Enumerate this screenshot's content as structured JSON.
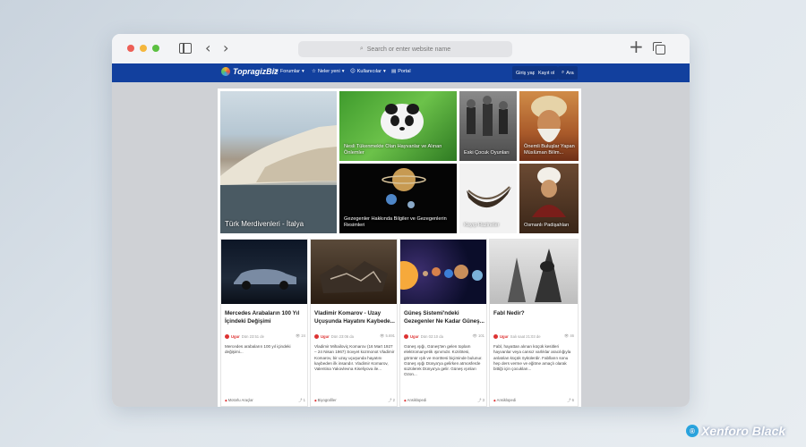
{
  "browser": {
    "url_placeholder": "Search or enter website name",
    "traffic_lights": [
      "#ed5f56",
      "#f5b73d",
      "#5cc041"
    ]
  },
  "forum": {
    "logo": "TopragizBiz",
    "nav": {
      "forums": "Forumlar",
      "whats_new": "Neler yeni",
      "members": "Kullanıcılar",
      "portal": "Portal",
      "login": "Giriş yap",
      "register": "Kayıt ol",
      "search": "Ara"
    },
    "colors": {
      "nav_bg": "#12409e",
      "accent_red": "#d33333"
    }
  },
  "featured": [
    {
      "title": "Türk Merdivenleri - İtalya"
    },
    {
      "title": "Nesli Tükenmekte Olan Hayvanlar ve Alınan Önlemler"
    },
    {
      "title": "Eski Çocuk Oyunları"
    },
    {
      "title": "Önemli Buluşlar Yapan Müslüman Bilim..."
    },
    {
      "title": "Gezegenler Hakkında Bilgiler ve Gezegenlerin Resimleri"
    },
    {
      "title": "Kayıp Hazineler"
    },
    {
      "title": "Osmanlı Padişahları"
    }
  ],
  "articles": [
    {
      "title": "Mercedes Arabaların 100 Yıl İçindeki Değişimi",
      "author": "Ugur",
      "date": "Dün 23:51 de",
      "views": "24",
      "excerpt": "Mercedes arabaların 100 yıl içindeki değişimi...",
      "category": "Motorlu Araçlar",
      "comments": "1"
    },
    {
      "title": "Vladimir Komarov - Uzay Uçuşunda Hayatını Kaybede...",
      "author": "Ugur",
      "date": "Dün 23:06 da",
      "views": "5.691",
      "excerpt": "Vladimir Mihailoviç Komarov (16 Mart 1927 – 24 Nisan 1967) Sovyet kozmonot Vladimir Komarov, bir uzay uçuşunda hayatını kaybeden ilk insandır. Vladimir Komarov, Valentina Yakovlevna Kiseliyova ile...",
      "category": "Biyografiler",
      "comments": "2"
    },
    {
      "title": "Güneş Sistemi'ndeki Gezegenler Ne Kadar Güneş...",
      "author": "Ugur",
      "date": "Dün 02:10 da",
      "views": "101",
      "excerpt": "Güneş ışığı, Güneş'ten gelen toplam elektromanyetik ışınımdır. Kızılötesi, görünür ışık ve morötesi biçiminde bulunur. Güneş ışığı Dünya'ya gelirken atmosferde süzülerek Dünya'ya gelir. Güneş ışınları Ozon...",
      "category": "Ansiklopedi",
      "comments": "3"
    },
    {
      "title": "Fabl Nedir?",
      "author": "Ugur",
      "date": "Salı saat 21:03 de",
      "views": "46",
      "excerpt": "Fabl, hayattan alınan küçük kesitleri hayvanlar veya cansız varlıklar aracılığıyla anlatılan küçük öykülerdir. Fablların sonu hep ders verme ve eğitme amaçlı olarak bittiği için çocukları...",
      "category": "Ansiklopedi",
      "comments": "6"
    }
  ],
  "watermark": "Xenforo Black"
}
